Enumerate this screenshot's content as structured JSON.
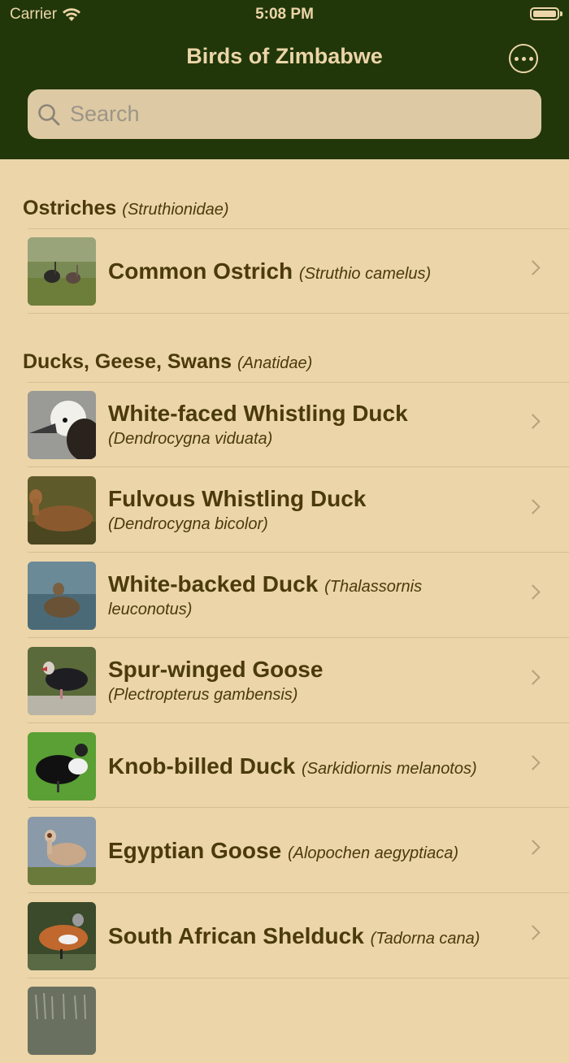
{
  "status": {
    "carrier": "Carrier",
    "time": "5:08 PM"
  },
  "nav": {
    "title": "Birds of Zimbabwe",
    "more_icon": "ellipsis-circle-icon"
  },
  "search": {
    "placeholder": "Search"
  },
  "sections": [
    {
      "name": "Ostriches",
      "latin": "(Struthionidae)",
      "items": [
        {
          "name": "Common Ostrich",
          "sci": "(Struthio camelus)"
        }
      ]
    },
    {
      "name": "Ducks, Geese, Swans",
      "latin": "(Anatidae)",
      "items": [
        {
          "name": "White-faced Whistling Duck",
          "sci": "(Dendrocygna viduata)"
        },
        {
          "name": "Fulvous Whistling Duck",
          "sci": "(Dendrocygna bicolor)"
        },
        {
          "name": "White-backed Duck",
          "sci": "(Thalassornis",
          "sci2": "leuconotus)"
        },
        {
          "name": "Spur-winged Goose",
          "sci": "(Plectropterus gambensis)"
        },
        {
          "name": "Knob-billed Duck",
          "sci": "(Sarkidiornis melanotos)"
        },
        {
          "name": "Egyptian Goose",
          "sci": "(Alopochen aegyptiaca)"
        },
        {
          "name": "South African Shelduck",
          "sci": "(Tadorna cana)"
        }
      ]
    }
  ],
  "colors": {
    "header": "#213709",
    "background": "#ecd5a8",
    "text": "#4a3a0c"
  }
}
